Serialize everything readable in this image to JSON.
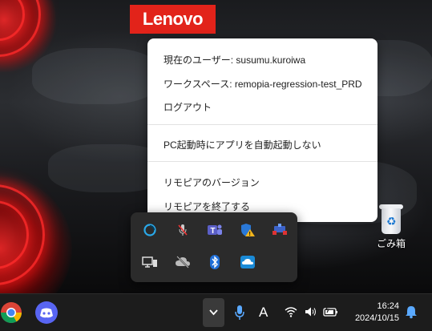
{
  "desktop": {
    "brand_logo": "Lenovo",
    "icons": [
      {
        "label": "ごみ箱",
        "icon": "recycle-bin-icon"
      }
    ]
  },
  "context_menu": {
    "items": [
      {
        "label": "現在のユーザー: susumu.kuroiwa"
      },
      {
        "label": "ワークスペース: remopia-regression-test_PRD"
      },
      {
        "label": "ログアウト"
      },
      {
        "label": "PC起動時にアプリを自動起動しない"
      },
      {
        "label": "リモピアのバージョン"
      },
      {
        "label": "リモピアを終了する"
      }
    ]
  },
  "tray_flyout": {
    "icons": [
      "remopia-app-icon",
      "microphone-muted-icon",
      "teams-icon",
      "security-warning-icon",
      "network-share-icon",
      "desktop-device-icon",
      "cloud-off-icon",
      "bluetooth-icon",
      "onedrive-sync-icon"
    ]
  },
  "taskbar": {
    "pinned_apps": [
      {
        "name": "chrome-icon"
      },
      {
        "name": "discord-icon"
      }
    ],
    "tray": {
      "overflow_icon": "chevron-down-icon",
      "ime_indicator": "A",
      "clock_time": "16:24",
      "clock_date": "2024/10/15"
    }
  },
  "colors": {
    "lenovo_red": "#e2231a",
    "menu_bg": "#ffffff",
    "flyout_bg": "#2b2b2b",
    "taskbar_bg": "#1c1c1c"
  }
}
